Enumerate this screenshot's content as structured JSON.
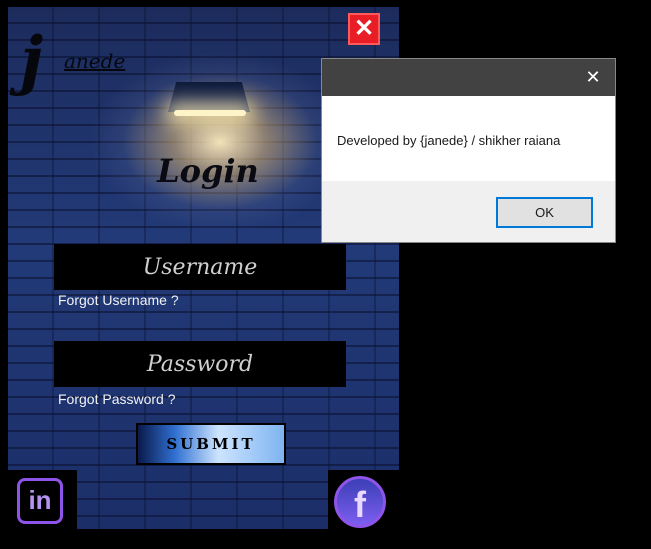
{
  "login_window": {
    "brand": {
      "letter": "j",
      "word": "anede"
    },
    "close_label": "✕",
    "title": "Login",
    "username_placeholder": "Username",
    "password_placeholder": "Password",
    "forgot_username": "Forgot Username  ?",
    "forgot_password": "Forgot Password  ?",
    "submit_label": "SUBMIT",
    "social": {
      "linkedin_label": "in",
      "facebook_label": "f"
    },
    "colors": {
      "close_button": "#e81d25",
      "social_accent": "#8e54e9"
    }
  },
  "dialog": {
    "title": "",
    "close_label": "✕",
    "message": "Developed by {janede} / shikher raiana",
    "ok_label": "OK"
  }
}
